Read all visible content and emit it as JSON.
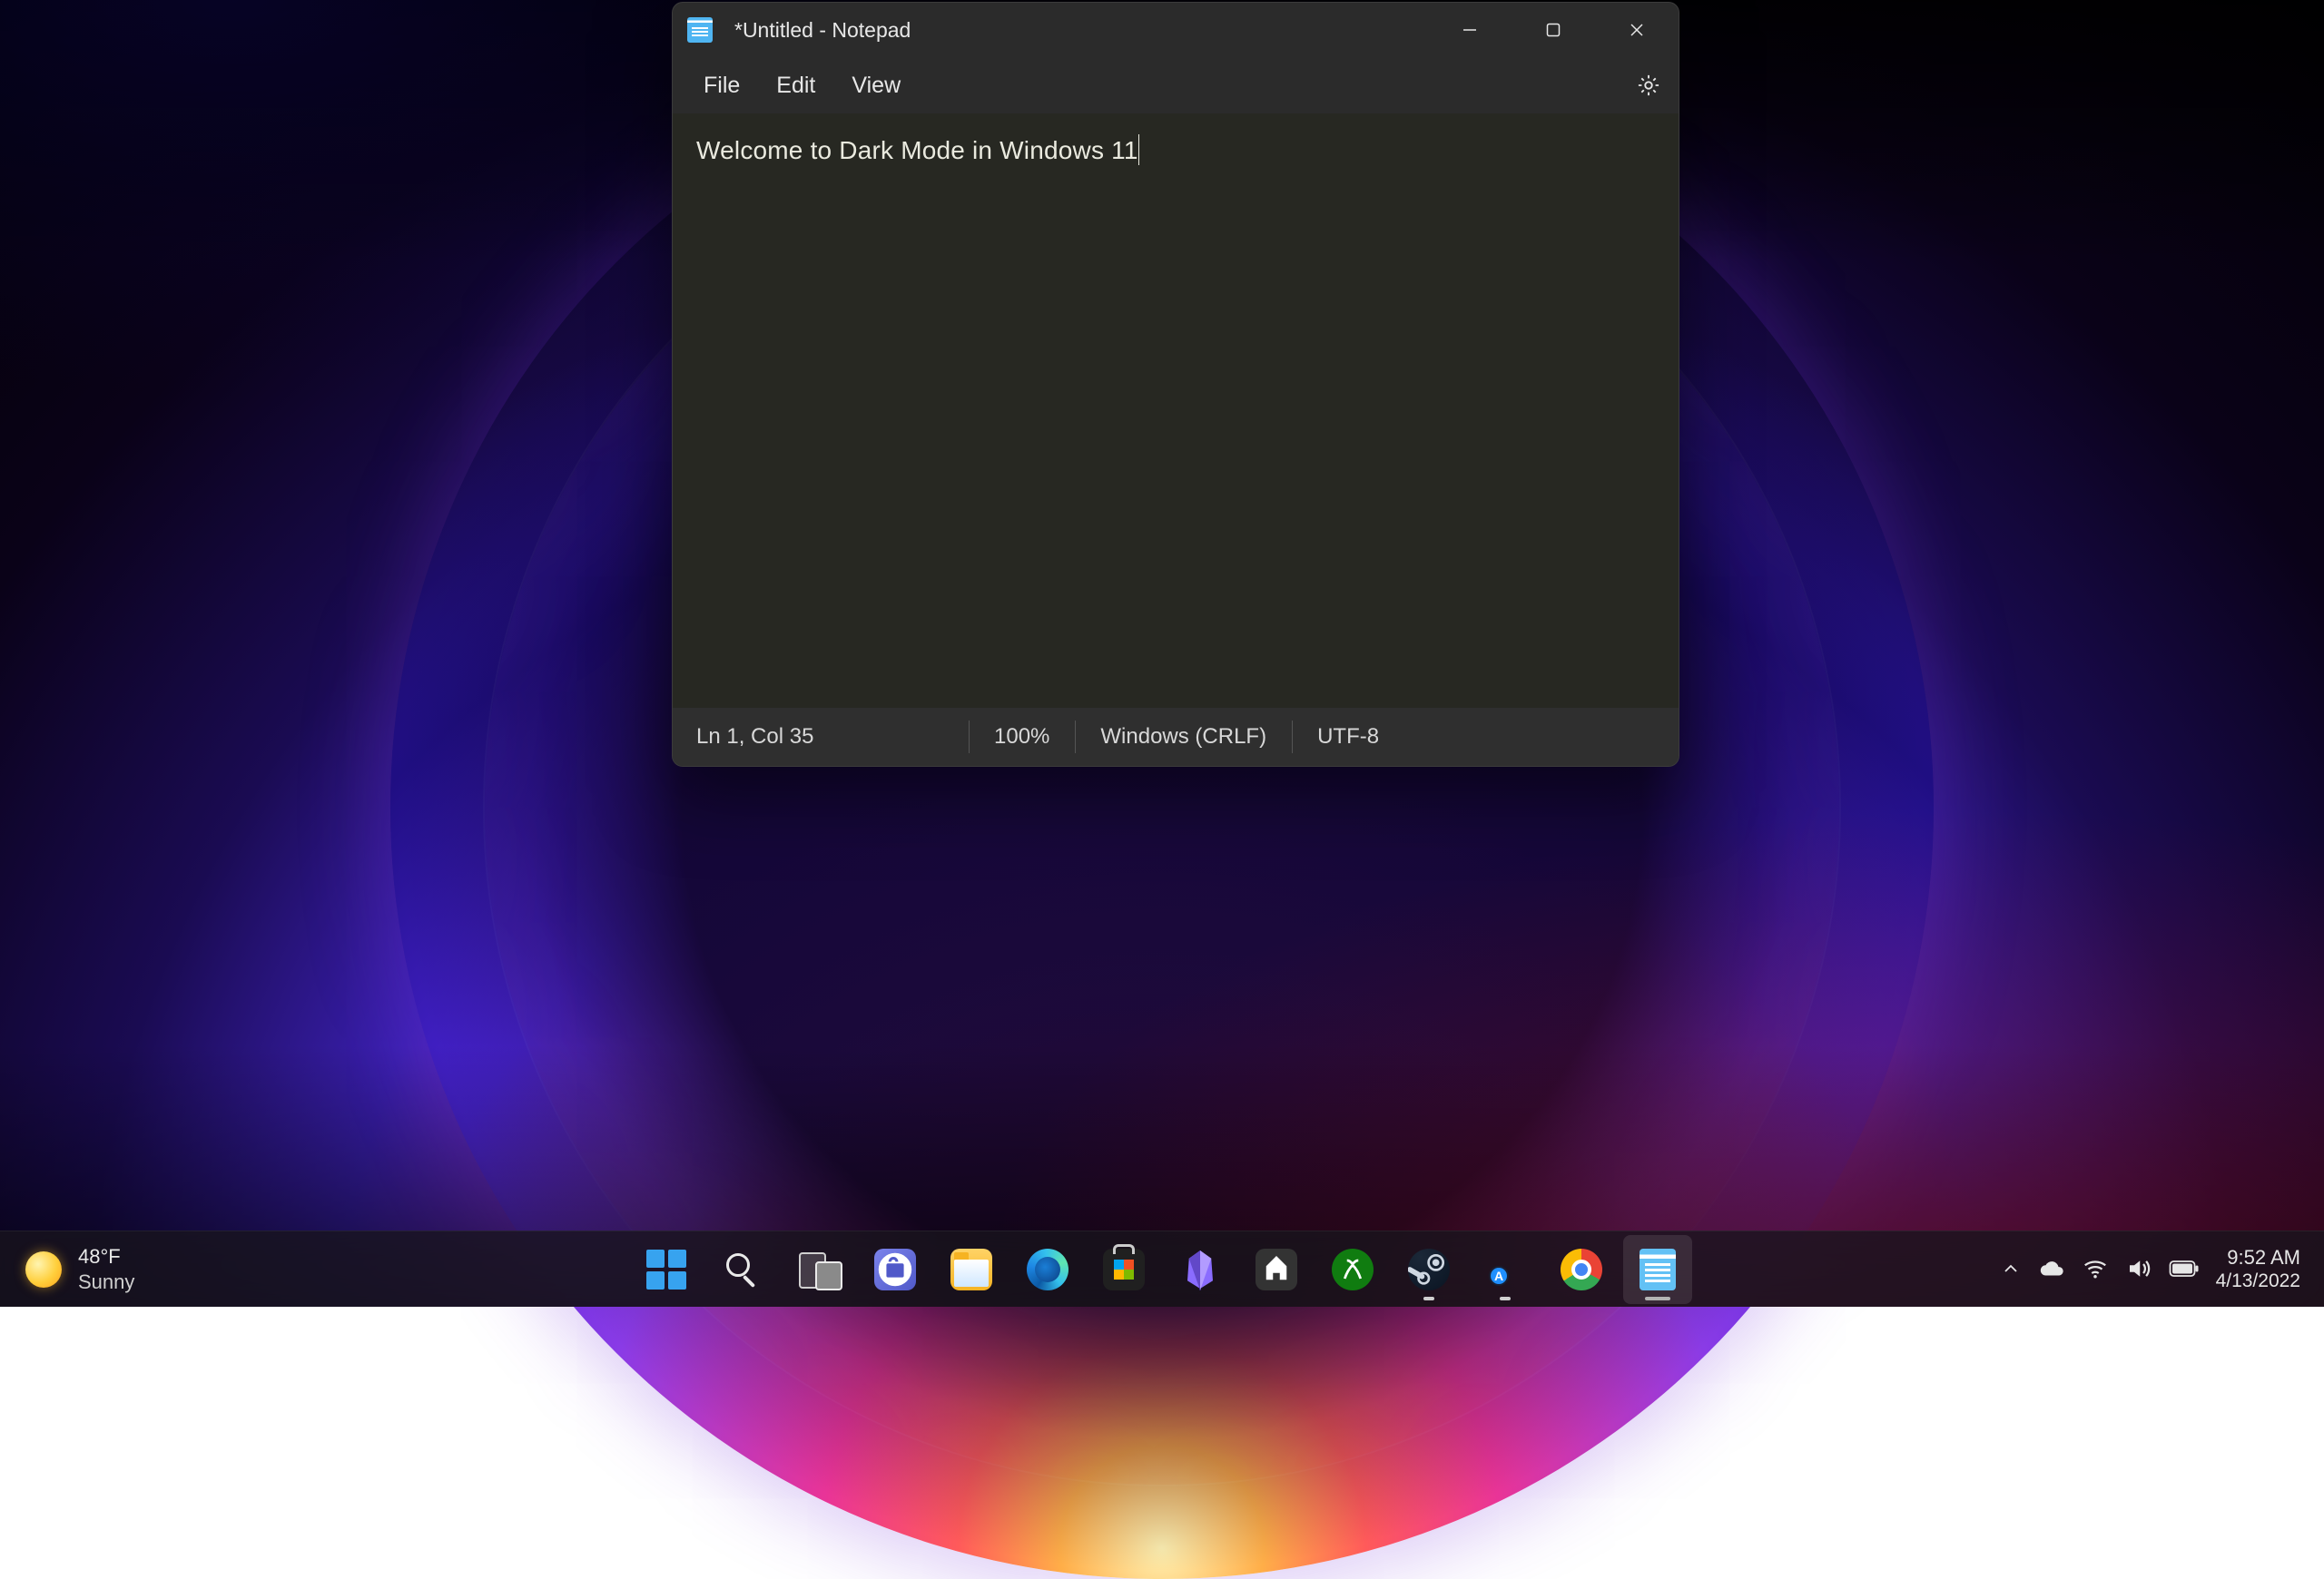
{
  "notepad": {
    "title": "*Untitled - Notepad",
    "menu": {
      "file": "File",
      "edit": "Edit",
      "view": "View"
    },
    "content": "Welcome to Dark Mode in Windows 11",
    "status": {
      "position": "Ln 1, Col 35",
      "zoom": "100%",
      "line_ending": "Windows (CRLF)",
      "encoding": "UTF-8"
    }
  },
  "taskbar": {
    "weather": {
      "temp": "48°F",
      "cond": "Sunny"
    },
    "whats_new_badge": "A",
    "clock": {
      "time": "9:52 AM",
      "date": "4/13/2022"
    }
  }
}
